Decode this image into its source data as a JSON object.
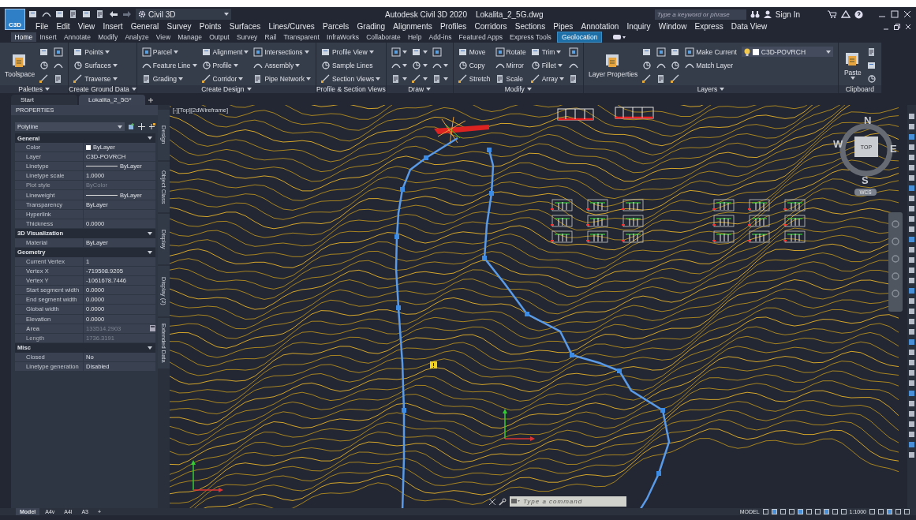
{
  "title_bar": {
    "app_button": "C3D",
    "workspace": "Civil 3D",
    "app_title": "Autodesk Civil 3D 2020",
    "file_name": "Lokalita_2_5G.dwg",
    "search": {
      "placeholder": "Type a keyword or phrase"
    },
    "sign_in": "Sign In"
  },
  "menu_bar": [
    "File",
    "Edit",
    "View",
    "Insert",
    "General",
    "Survey",
    "Points",
    "Surfaces",
    "Lines/Curves",
    "Parcels",
    "Grading",
    "Alignments",
    "Profiles",
    "Corridors",
    "Sections",
    "Pipes",
    "Annotation",
    "Inquiry",
    "Window",
    "Express",
    "Data View"
  ],
  "ribbon_tabs": [
    {
      "label": "Home",
      "selected": true,
      "contextual": false
    },
    {
      "label": "Insert",
      "selected": false,
      "contextual": false
    },
    {
      "label": "Annotate",
      "selected": false,
      "contextual": false
    },
    {
      "label": "Modify",
      "selected": false,
      "contextual": false
    },
    {
      "label": "Analyze",
      "selected": false,
      "contextual": false
    },
    {
      "label": "View",
      "selected": false,
      "contextual": false
    },
    {
      "label": "Manage",
      "selected": false,
      "contextual": false
    },
    {
      "label": "Output",
      "selected": false,
      "contextual": false
    },
    {
      "label": "Survey",
      "selected": false,
      "contextual": false
    },
    {
      "label": "Rail",
      "selected": false,
      "contextual": false
    },
    {
      "label": "Transparent",
      "selected": false,
      "contextual": false
    },
    {
      "label": "InfraWorks",
      "selected": false,
      "contextual": false
    },
    {
      "label": "Collaborate",
      "selected": false,
      "contextual": false
    },
    {
      "label": "Help",
      "selected": false,
      "contextual": false
    },
    {
      "label": "Add-ins",
      "selected": false,
      "contextual": false
    },
    {
      "label": "Featured Apps",
      "selected": false,
      "contextual": false
    },
    {
      "label": "Express Tools",
      "selected": false,
      "contextual": false
    },
    {
      "label": "Geolocation",
      "selected": false,
      "contextual": true
    }
  ],
  "ribbon_panels": [
    {
      "title": "Palettes",
      "menu": true,
      "items": [
        {
          "kind": "large",
          "label": "Toolspace",
          "menu": false
        },
        {
          "kind": "icon",
          "menu": false
        },
        {
          "kind": "icon",
          "menu": false
        },
        {
          "kind": "icon",
          "menu": false
        },
        {
          "kind": "icon",
          "menu": false
        },
        {
          "kind": "icon",
          "menu": false
        },
        {
          "kind": "icon",
          "menu": false
        }
      ]
    },
    {
      "title": "Create Ground Data",
      "menu": true,
      "items": [
        {
          "kind": "small",
          "label": "Points",
          "menu": true
        },
        {
          "kind": "small",
          "label": "Surfaces",
          "menu": true
        },
        {
          "kind": "small",
          "label": "Traverse",
          "menu": true
        }
      ]
    },
    {
      "title": "Create Design",
      "menu": true,
      "items": [
        {
          "kind": "small",
          "label": "Parcel",
          "menu": true
        },
        {
          "kind": "small",
          "label": "Feature Line",
          "menu": true
        },
        {
          "kind": "small",
          "label": "Grading",
          "menu": true
        },
        {
          "kind": "small",
          "label": "Alignment",
          "menu": true
        },
        {
          "kind": "small",
          "label": "Profile",
          "menu": true
        },
        {
          "kind": "small",
          "label": "Corridor",
          "menu": true
        },
        {
          "kind": "small",
          "label": "Intersections",
          "menu": true
        },
        {
          "kind": "small",
          "label": "Assembly",
          "menu": true
        },
        {
          "kind": "small",
          "label": "Pipe Network",
          "menu": true
        }
      ]
    },
    {
      "title": "Profile & Section Views",
      "menu": false,
      "items": [
        {
          "kind": "small",
          "label": "Profile View",
          "menu": true
        },
        {
          "kind": "small",
          "label": "Sample Lines",
          "menu": false
        },
        {
          "kind": "small",
          "label": "Section Views",
          "menu": true
        }
      ]
    },
    {
      "title": "Draw",
      "menu": true,
      "items": [
        {
          "kind": "icon",
          "menu": true
        },
        {
          "kind": "icon",
          "menu": true
        },
        {
          "kind": "icon",
          "menu": true
        },
        {
          "kind": "icon",
          "menu": true
        },
        {
          "kind": "icon",
          "menu": true
        },
        {
          "kind": "icon",
          "menu": true
        },
        {
          "kind": "icon",
          "menu": false
        },
        {
          "kind": "icon",
          "menu": true
        },
        {
          "kind": "icon",
          "menu": true
        }
      ]
    },
    {
      "title": "Modify",
      "menu": true,
      "items": [
        {
          "kind": "small",
          "label": "Move",
          "menu": false
        },
        {
          "kind": "small",
          "label": "Copy",
          "menu": false
        },
        {
          "kind": "small",
          "label": "Stretch",
          "menu": false
        },
        {
          "kind": "small",
          "label": "Rotate",
          "menu": false
        },
        {
          "kind": "small",
          "label": "Mirror",
          "menu": false
        },
        {
          "kind": "small",
          "label": "Scale",
          "menu": false
        },
        {
          "kind": "small",
          "label": "Trim",
          "menu": true
        },
        {
          "kind": "small",
          "label": "Fillet",
          "menu": true
        },
        {
          "kind": "small",
          "label": "Array",
          "menu": true
        },
        {
          "kind": "icon",
          "menu": false
        },
        {
          "kind": "icon",
          "menu": false
        },
        {
          "kind": "icon",
          "menu": false
        }
      ]
    },
    {
      "title": "Layers",
      "menu": true,
      "items": [
        {
          "kind": "large",
          "label": "Layer Properties",
          "menu": false
        },
        {
          "kind": "icon",
          "menu": false
        },
        {
          "kind": "icon",
          "menu": false
        },
        {
          "kind": "icon",
          "menu": false
        },
        {
          "kind": "icon",
          "menu": false
        },
        {
          "kind": "icon",
          "menu": false
        },
        {
          "kind": "icon",
          "menu": false
        },
        {
          "kind": "icon",
          "menu": false
        },
        {
          "kind": "icon",
          "menu": false
        },
        {
          "kind": "icon",
          "menu": false
        },
        {
          "kind": "layer",
          "label": "C3D-POVRCH",
          "menu": true
        },
        {
          "kind": "small",
          "label": "Make Current",
          "menu": false
        },
        {
          "kind": "small",
          "label": "Match Layer",
          "menu": false
        }
      ]
    },
    {
      "title": "Clipboard",
      "menu": false,
      "items": [
        {
          "kind": "large",
          "label": "Paste",
          "menu": true
        },
        {
          "kind": "icon",
          "menu": false
        },
        {
          "kind": "icon",
          "menu": false
        },
        {
          "kind": "icon",
          "menu": false
        }
      ]
    }
  ],
  "document_tabs": [
    {
      "label": "Start",
      "selected": false
    },
    {
      "label": "Lokalita_2_5G*",
      "selected": true
    }
  ],
  "properties": {
    "title": "PROPERTIES",
    "object_type": "Polyline",
    "sections": [
      {
        "title": "General",
        "expanded": true,
        "rows": [
          {
            "name": "Color",
            "value": "ByLayer",
            "kind": "color",
            "disabled": false,
            "bold": false
          },
          {
            "name": "Layer",
            "value": "C3D-POVRCH",
            "kind": "text",
            "disabled": false,
            "bold": false
          },
          {
            "name": "Linetype",
            "value": "ByLayer",
            "kind": "line",
            "disabled": false,
            "bold": false
          },
          {
            "name": "Linetype scale",
            "value": "1.0000",
            "kind": "text",
            "disabled": false,
            "bold": false
          },
          {
            "name": "Plot style",
            "value": "ByColor",
            "kind": "text",
            "disabled": true,
            "bold": false
          },
          {
            "name": "Lineweight",
            "value": "ByLayer",
            "kind": "line",
            "disabled": false,
            "bold": false
          },
          {
            "name": "Transparency",
            "value": "ByLayer",
            "kind": "text",
            "disabled": false,
            "bold": false
          },
          {
            "name": "Hyperlink",
            "kind": "text",
            "disabled": false,
            "bold": false
          },
          {
            "name": "Thickness",
            "value": "0.0000",
            "kind": "text",
            "disabled": false,
            "bold": false
          }
        ]
      },
      {
        "title": "3D Visualization",
        "expanded": true,
        "rows": [
          {
            "name": "Material",
            "value": "ByLayer",
            "kind": "text",
            "disabled": false,
            "bold": false
          }
        ]
      },
      {
        "title": "Geometry",
        "expanded": true,
        "rows": [
          {
            "name": "Current Vertex",
            "value": "1",
            "kind": "text",
            "disabled": false,
            "bold": false
          },
          {
            "name": "Vertex X",
            "value": "-719508.9205",
            "kind": "text",
            "disabled": false,
            "bold": false
          },
          {
            "name": "Vertex Y",
            "value": "-1061678.7446",
            "kind": "text",
            "disabled": false,
            "bold": false
          },
          {
            "name": "Start segment width",
            "value": "0.0000",
            "kind": "text",
            "disabled": false,
            "bold": false
          },
          {
            "name": "End segment width",
            "value": "0.0000",
            "kind": "text",
            "disabled": false,
            "bold": false
          },
          {
            "name": "Global width",
            "value": "0.0000",
            "kind": "text",
            "disabled": false,
            "bold": false
          },
          {
            "name": "Elevation",
            "value": "0.0000",
            "kind": "text",
            "disabled": false,
            "bold": false
          },
          {
            "name": "Area",
            "value": "133514.2903",
            "kind": "calc",
            "disabled": true,
            "bold": true
          },
          {
            "name": "Length",
            "value": "1736.3191",
            "kind": "text",
            "disabled": true,
            "bold": false
          }
        ]
      },
      {
        "title": "Misc",
        "expanded": true,
        "rows": [
          {
            "name": "Closed",
            "value": "No",
            "kind": "text",
            "disabled": false,
            "bold": false
          },
          {
            "name": "Linetype generation",
            "value": "Disabled",
            "kind": "text",
            "disabled": false,
            "bold": false
          }
        ]
      }
    ]
  },
  "side_tabs": [
    "Design",
    "Object Class",
    "Display",
    "Display (2)",
    "Extended Data"
  ],
  "viewport": {
    "label": "[-][Top][2dWireframe]",
    "compass": {
      "north": "N",
      "south": "S",
      "east": "E",
      "west": "W",
      "top": "TOP"
    },
    "ucs": "WCS"
  },
  "command_line": {
    "placeholder": "Type a command"
  },
  "layout_tabs": [
    {
      "label": "Model",
      "selected": true
    },
    {
      "label": "A4v",
      "selected": false
    },
    {
      "label": "A4l",
      "selected": false
    },
    {
      "label": "A3",
      "selected": false
    }
  ],
  "status_bar": {
    "add_layout": "+",
    "mode": "MODEL",
    "scale": "1:1000"
  }
}
